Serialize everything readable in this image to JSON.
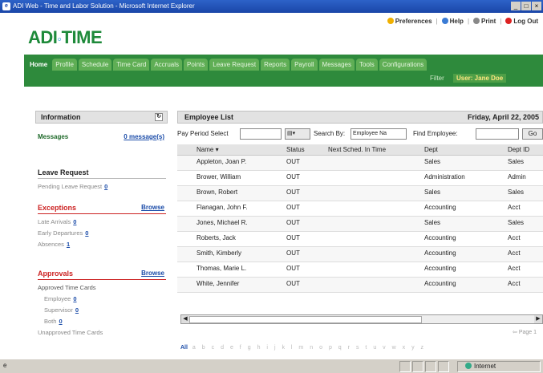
{
  "window": {
    "title": "ADI Web - Time and Labor Solution - Microsoft Internet Explorer"
  },
  "header": {
    "logo": "ADI",
    "logo_suffix": "TIME",
    "links": [
      "Preferences",
      "Help",
      "Print",
      "Log Out"
    ]
  },
  "tabs": [
    "Home",
    "Profile",
    "Schedule",
    "Time Card",
    "Accruals",
    "Points",
    "Leave Request",
    "Reports",
    "Payroll",
    "Messages",
    "Tools",
    "Configurations"
  ],
  "active_tab": "Home",
  "userbar": {
    "filter": "Filter",
    "user": "User: Jane Doe"
  },
  "left": {
    "title": "Information",
    "messages_label": "Messages",
    "messages_link": "0 message(s)",
    "leave": {
      "title": "Leave Request",
      "pending_label": "Pending Leave Request",
      "pending_count": "0"
    },
    "exceptions": {
      "title": "Exceptions",
      "browse": "Browse",
      "items": [
        {
          "label": "Late Arrivals",
          "count": "0"
        },
        {
          "label": "Early Departures",
          "count": "0"
        },
        {
          "label": "Absences",
          "count": "1"
        }
      ]
    },
    "approvals": {
      "title": "Approvals",
      "browse": "Browse",
      "sub_title": "Approved Time Cards",
      "items": [
        {
          "label": "Employee",
          "count": "0"
        },
        {
          "label": "Supervisor",
          "count": "0"
        },
        {
          "label": "Both",
          "count": "0"
        }
      ],
      "unapproved": "Unapproved Time Cards"
    }
  },
  "employee_list": {
    "title": "Employee List",
    "date": "Friday, April 22, 2005",
    "filters": {
      "pay_period": "Pay Period Select",
      "search_by": "Search By:",
      "search_by_value": "Employee Na",
      "find": "Find Employee:",
      "go": "Go"
    },
    "columns": [
      "Name",
      "Status",
      "Next Sched. In Time",
      "Dept",
      "Dept ID"
    ],
    "rows": [
      {
        "name": "Appleton, Joan P.",
        "status": "OUT",
        "dept": "Sales",
        "dept_id": "Sales"
      },
      {
        "name": "Brower, William",
        "status": "OUT",
        "dept": "Administration",
        "dept_id": "Admin"
      },
      {
        "name": "Brown, Robert",
        "status": "OUT",
        "dept": "Sales",
        "dept_id": "Sales"
      },
      {
        "name": "Flanagan, John F.",
        "status": "OUT",
        "dept": "Accounting",
        "dept_id": "Acct"
      },
      {
        "name": "Jones, Michael R.",
        "status": "OUT",
        "dept": "Sales",
        "dept_id": "Sales"
      },
      {
        "name": "Roberts, Jack",
        "status": "OUT",
        "dept": "Accounting",
        "dept_id": "Acct"
      },
      {
        "name": "Smith, Kimberly",
        "status": "OUT",
        "dept": "Accounting",
        "dept_id": "Acct"
      },
      {
        "name": "Thomas, Marie L.",
        "status": "OUT",
        "dept": "Accounting",
        "dept_id": "Acct"
      },
      {
        "name": "White, Jennifer",
        "status": "OUT",
        "dept": "Accounting",
        "dept_id": "Acct"
      }
    ],
    "page": "Page 1",
    "alpha_all": "All",
    "alpha": [
      "a",
      "b",
      "c",
      "d",
      "e",
      "f",
      "g",
      "h",
      "i",
      "j",
      "k",
      "l",
      "m",
      "n",
      "o",
      "p",
      "q",
      "r",
      "s",
      "t",
      "u",
      "v",
      "w",
      "x",
      "y",
      "z"
    ]
  },
  "statusbar": {
    "zone": "Internet"
  },
  "colors": {
    "nav_green": "#2e8a3c",
    "tab_green": "#5fae55",
    "link_blue": "#1a4ba8",
    "exception_red": "#cc2222"
  }
}
